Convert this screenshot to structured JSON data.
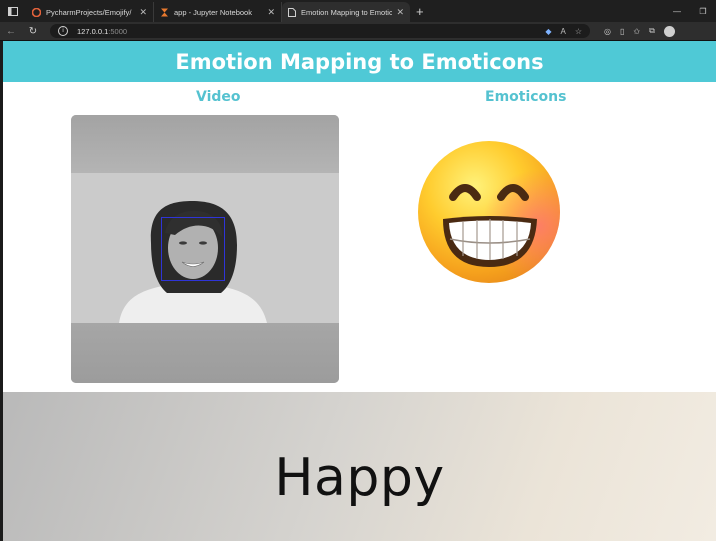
{
  "browser": {
    "tabs": [
      {
        "title": "PycharmProjects/Emojify/",
        "icon": "gitlab-icon"
      },
      {
        "title": "app - Jupyter Notebook",
        "icon": "hourglass-icon"
      },
      {
        "title": "Emotion Mapping to Emoticons",
        "icon": "page-icon"
      }
    ],
    "address": {
      "host": "127.0.0.1",
      "port": ":5000"
    }
  },
  "page": {
    "title": "Emotion Mapping to Emoticons",
    "video_label": "Video",
    "emoticons_label": "Emoticons",
    "emotion": "Happy"
  },
  "colors": {
    "header_bg": "#4fc9d6",
    "label_color": "#55c2d0",
    "face_box": "#2f34d8"
  }
}
